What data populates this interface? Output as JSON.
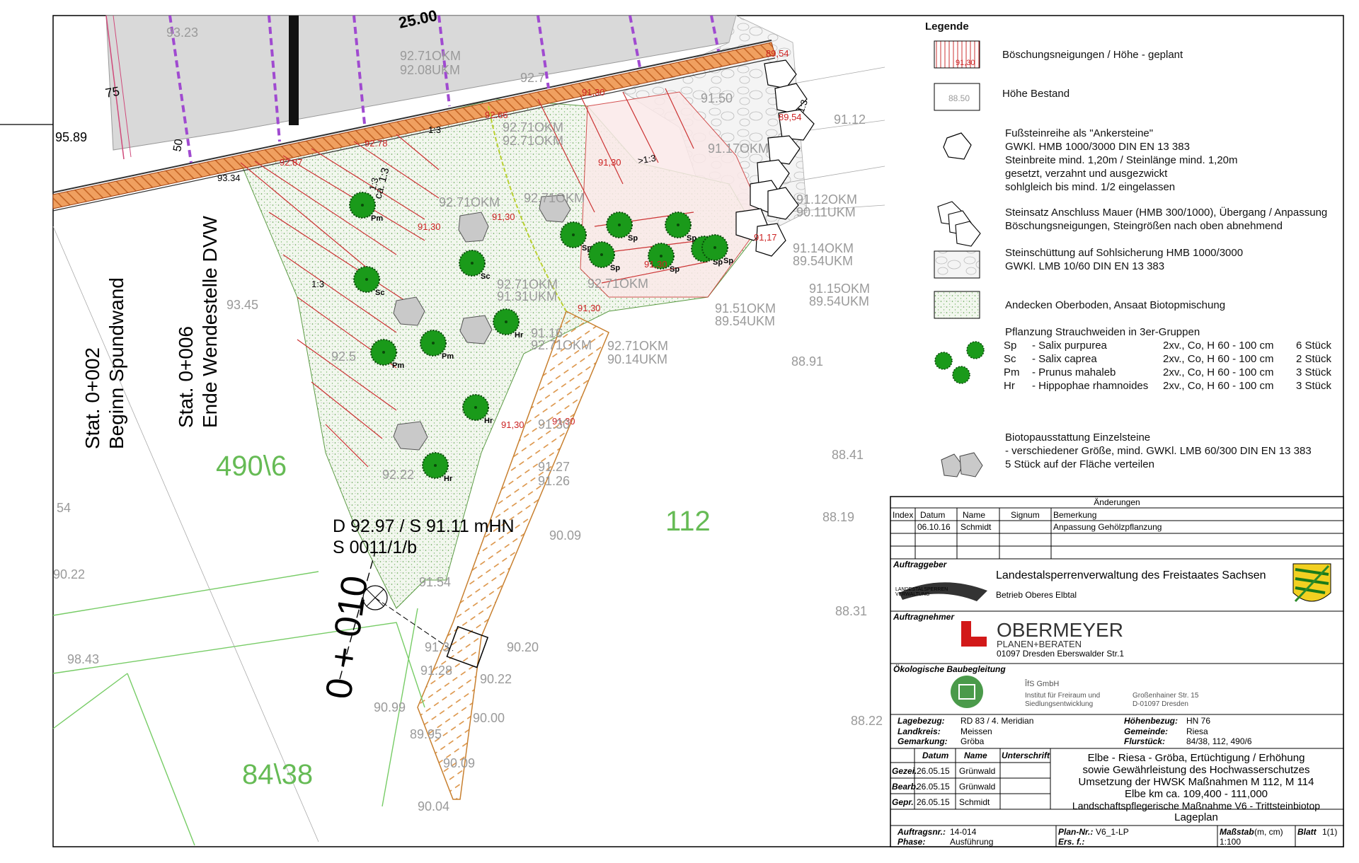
{
  "legend": {
    "title": "Legende",
    "items": {
      "slope_planned": "Böschungsneigungen / Höhe - geplant",
      "slope_sample": "91,30",
      "height_existing": "Höhe Bestand",
      "height_sample": "88.50",
      "anchor_stones": [
        "Fußsteinreihe als \"Ankersteine\"",
        "GWKl. HMB 1000/3000 DIN EN 13 383",
        "Steinbreite mind. 1,20m / Steinlänge mind. 1,20m",
        "gesetzt, verzahnt und ausgezwickt",
        "sohlgleich bis mind. 1/2 eingelassen"
      ],
      "stone_set": [
        "Steinsatz Anschluss Mauer (HMB 300/1000), Übergang / Anpassung",
        "Böschungsneigungen, Steingrößen nach oben abnehmend"
      ],
      "riprap": [
        "Steinschüttung auf Sohlsicherung HMB 1000/3000",
        "GWKl. LMB 10/60 DIN EN 13 383"
      ],
      "topsoil": "Andecken Oberboden, Ansaat Biotopmischung",
      "planting_title": "Pflanzung Strauchweiden in 3er-Gruppen",
      "planting_rows": [
        {
          "code": "Sp",
          "name": "- Salix purpurea",
          "spec": "2xv., Co, H 60 - 100 cm",
          "count": "6 Stück"
        },
        {
          "code": "Sc",
          "name": "- Salix caprea",
          "spec": "2xv., Co, H 60 - 100 cm",
          "count": "2 Stück"
        },
        {
          "code": "Pm",
          "name": "- Prunus mahaleb",
          "spec": "2xv., Co, H 60 - 100 cm",
          "count": "3 Stück"
        },
        {
          "code": "Hr",
          "name": "- Hippophae rhamnoides",
          "spec": "2xv., Co, H 60 - 100 cm",
          "count": "3 Stück"
        }
      ],
      "single_stones": [
        "Biotopausstattung Einzelsteine",
        "- verschiedener Größe, mind. GWKl. LMB 60/300 DIN EN 13 383",
        "  5 Stück auf der Fläche verteilen"
      ]
    }
  },
  "changes": {
    "title": "Änderungen",
    "headers": [
      "Index",
      "Datum",
      "Name",
      "Signum",
      "Bemerkung"
    ],
    "row": [
      "",
      "06.10.16",
      "Schmidt",
      "",
      "Anpassung Gehölzpflanzung"
    ]
  },
  "client": {
    "label": "Auftraggeber",
    "name": "Landestalsperrenverwaltung des Freistaates Sachsen",
    "branch": "Betrieb Oberes Elbtal",
    "logo_text": [
      "LANDESTALSPERREN",
      "VERWALTUNG"
    ]
  },
  "contractor": {
    "label": "Auftragnehmer",
    "name": "OBERMEYER",
    "sub": "PLANEN+BERATEN",
    "address": "01097 Dresden  Eberswalder Str.1"
  },
  "eco": {
    "label": "Ökologische Baubegleitung",
    "company": "ÎfS GmbH",
    "lines": [
      "Institut für Freiraum und",
      "Siedlungsentwicklung"
    ],
    "address": [
      "Großenhainer Str. 15",
      "D-01097 Dresden"
    ]
  },
  "meta": {
    "left": [
      {
        "k": "Lagebezug:",
        "v": "RD 83 / 4. Meridian"
      },
      {
        "k": "Landkreis:",
        "v": "Meissen"
      },
      {
        "k": "Gemarkung:",
        "v": "Gröba"
      }
    ],
    "right": [
      {
        "k": "Höhenbezug:",
        "v": "HN 76"
      },
      {
        "k": "Gemeinde:",
        "v": "Riesa"
      },
      {
        "k": "Flurstück:",
        "v": "84/38, 112, 490/6"
      }
    ]
  },
  "approval": {
    "headers": [
      "Datum",
      "Name",
      "Unterschrift"
    ],
    "rows": [
      {
        "k": "Gezei.",
        "d": "26.05.15",
        "n": "Grünwald"
      },
      {
        "k": "Bearb.",
        "d": "26.05.15",
        "n": "Grünwald"
      },
      {
        "k": "Gepr.",
        "d": "26.05.15",
        "n": "Schmidt"
      }
    ]
  },
  "project": {
    "lines": [
      "Elbe - Riesa - Gröba, Ertüchtigung / Erhöhung",
      "sowie Gewährleistung des Hochwasserschutzes",
      "Umsetzung der HWSK Maßnahmen M 112, M 114",
      "Elbe km ca. 109,400 - 111,000",
      "Landschaftspflegerische Maßnahme V6 - Trittsteinbiotop",
      "Lageplan"
    ]
  },
  "footer": {
    "order_k": "Auftragsnr.:",
    "order_v": "14-014",
    "phase_k": "Phase:",
    "phase_v": "Ausführung",
    "plan_k": "Plan-Nr.:",
    "plan_v": "V6_1-LP",
    "ers_k": "Ers. f.:",
    "scale_k": "Maßstab",
    "scale_unit": "(m, cm)",
    "scale_v": "1:100",
    "sheet_k": "Blatt",
    "sheet_v": "1(1)"
  },
  "map": {
    "dim_top": "25.00",
    "dim_75": "75",
    "dim_50": "50",
    "h_left": "95.89",
    "h_corner": "93.34",
    "station1": [
      "Stat. 0+002",
      "Beginn Spundwand"
    ],
    "station2": [
      "Stat. 0+006",
      "Ende Wendestelle DVW"
    ],
    "station_big": "0 + 010",
    "parcels": [
      "490\\6",
      "112",
      "84\\38"
    ],
    "survey": [
      "D 92.97 / S 91.11 mHN",
      "S 0011/1/b"
    ],
    "slopes": [
      "1:3",
      "1:3",
      "ca. 1:3",
      "1:3",
      ">1:3",
      "1:3"
    ],
    "red_heights": [
      "92.66",
      "91,30",
      "92.78",
      "92.87",
      "91,30",
      "91,30",
      "91,30",
      "91,30",
      "89,54",
      "89,54",
      "91,30",
      "91,30",
      "91,17",
      "91,30"
    ],
    "gray_heights": [
      "93.23",
      "92.71OKM",
      "92.08UKM",
      "92.71OKM",
      "92.71OKM",
      "92.71OKM",
      "92.71OKM",
      "92.71OKM",
      "91.31UKM",
      "92.71OKM",
      "91.16",
      "92.71OKM",
      "92.71OKM",
      "90.14UKM",
      "91.51OKM",
      "89.54UKM",
      "91.15OKM",
      "89.54UKM",
      "91.14OKM",
      "89.54UKM",
      "91.12OKM",
      "90.11UKM",
      "91.17OKM",
      "91.12",
      "91.50",
      "92.7",
      "93.45",
      "88.91",
      "88.41",
      "88.19",
      "88.31",
      "88.22",
      "91.27",
      "91.26",
      "90.09",
      "91.54",
      "90.20",
      "90.22",
      "90.00",
      "89.95",
      "90.09",
      "90.04",
      "90.99",
      "91.28",
      "91.3",
      "98.43",
      "90.22",
      "54",
      "92.5",
      "92.22",
      "91.30"
    ],
    "plants": [
      "Pm",
      "Sc",
      "Pm",
      "Pm",
      "Sc",
      "Hr",
      "Hr",
      "Hr",
      "Sp",
      "Sp",
      "Sp",
      "Sp",
      "Sp",
      "Sp",
      "Sp"
    ]
  }
}
